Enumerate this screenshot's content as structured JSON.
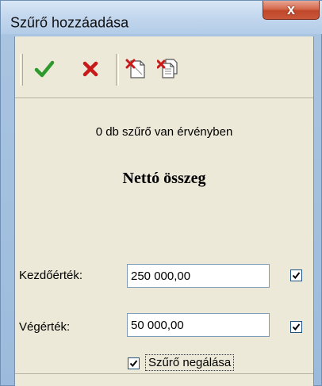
{
  "window": {
    "title": "Szűrő hozzáadása",
    "close_label": "x"
  },
  "toolbar": {
    "buttons": [
      {
        "icon": "checkmark-icon",
        "name": "ok"
      },
      {
        "icon": "x-icon",
        "name": "cancel"
      },
      {
        "icon": "delete-filter-icon",
        "name": "remove-filter"
      },
      {
        "icon": "delete-all-filters-icon",
        "name": "remove-all-filters"
      }
    ]
  },
  "content": {
    "status_text": "0 db szűrő van érvényben",
    "section_title": "Nettó összeg",
    "start_label": "Kezdőérték:",
    "start_value": "250 000,00",
    "start_checked": true,
    "end_label": "Végérték:",
    "end_value": "50 000,00",
    "end_checked": true,
    "negate_label": "Szűrő negálása",
    "negate_checked": true
  },
  "colors": {
    "ok_green": "#2e9a2e",
    "cancel_red": "#c81a1a",
    "client_bg": "#ece9d8"
  }
}
